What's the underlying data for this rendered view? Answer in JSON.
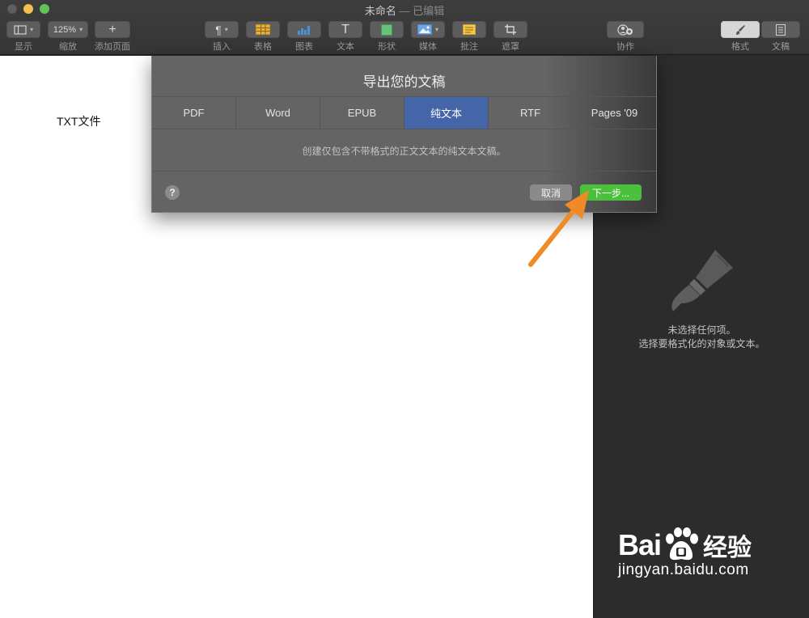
{
  "window": {
    "title": "未命名",
    "separator": " — ",
    "status": "已编辑"
  },
  "toolbar": {
    "view": {
      "label": "显示"
    },
    "zoom": {
      "value": "125%",
      "label": "缩放"
    },
    "add_page": {
      "icon": "+",
      "label": "添加页面"
    },
    "insert": {
      "icon": "¶",
      "label": "插入"
    },
    "table": {
      "label": "表格"
    },
    "chart": {
      "label": "图表"
    },
    "text": {
      "icon": "T",
      "label": "文本"
    },
    "shape": {
      "label": "形状"
    },
    "media": {
      "label": "媒体"
    },
    "comment": {
      "label": "批注"
    },
    "mask": {
      "label": "遮罩"
    },
    "collaborate": {
      "label": "协作"
    },
    "format": {
      "label": "格式"
    },
    "document": {
      "label": "文稿"
    }
  },
  "canvas": {
    "text": "TXT文件"
  },
  "dialog": {
    "title": "导出您的文稿",
    "tabs": [
      {
        "label": "PDF",
        "active": false
      },
      {
        "label": "Word",
        "active": false
      },
      {
        "label": "EPUB",
        "active": false
      },
      {
        "label": "纯文本",
        "active": true
      },
      {
        "label": "RTF",
        "active": false
      },
      {
        "label": "Pages '09",
        "active": false
      }
    ],
    "description": "创建仅包含不带格式的正文文本的纯文本文稿。",
    "help": "?",
    "cancel": "取消",
    "next": "下一步..."
  },
  "inspector": {
    "line1": "未选择任何项。",
    "line2": "选择要格式化的对象或文本。"
  },
  "watermark": {
    "brand": "Bai",
    "brand_cn": "经验",
    "url": "jingyan.baidu.com"
  },
  "colors": {
    "active_tab": "#4466a8",
    "next_button": "#4cbf3c",
    "arrow": "#f08a24"
  }
}
